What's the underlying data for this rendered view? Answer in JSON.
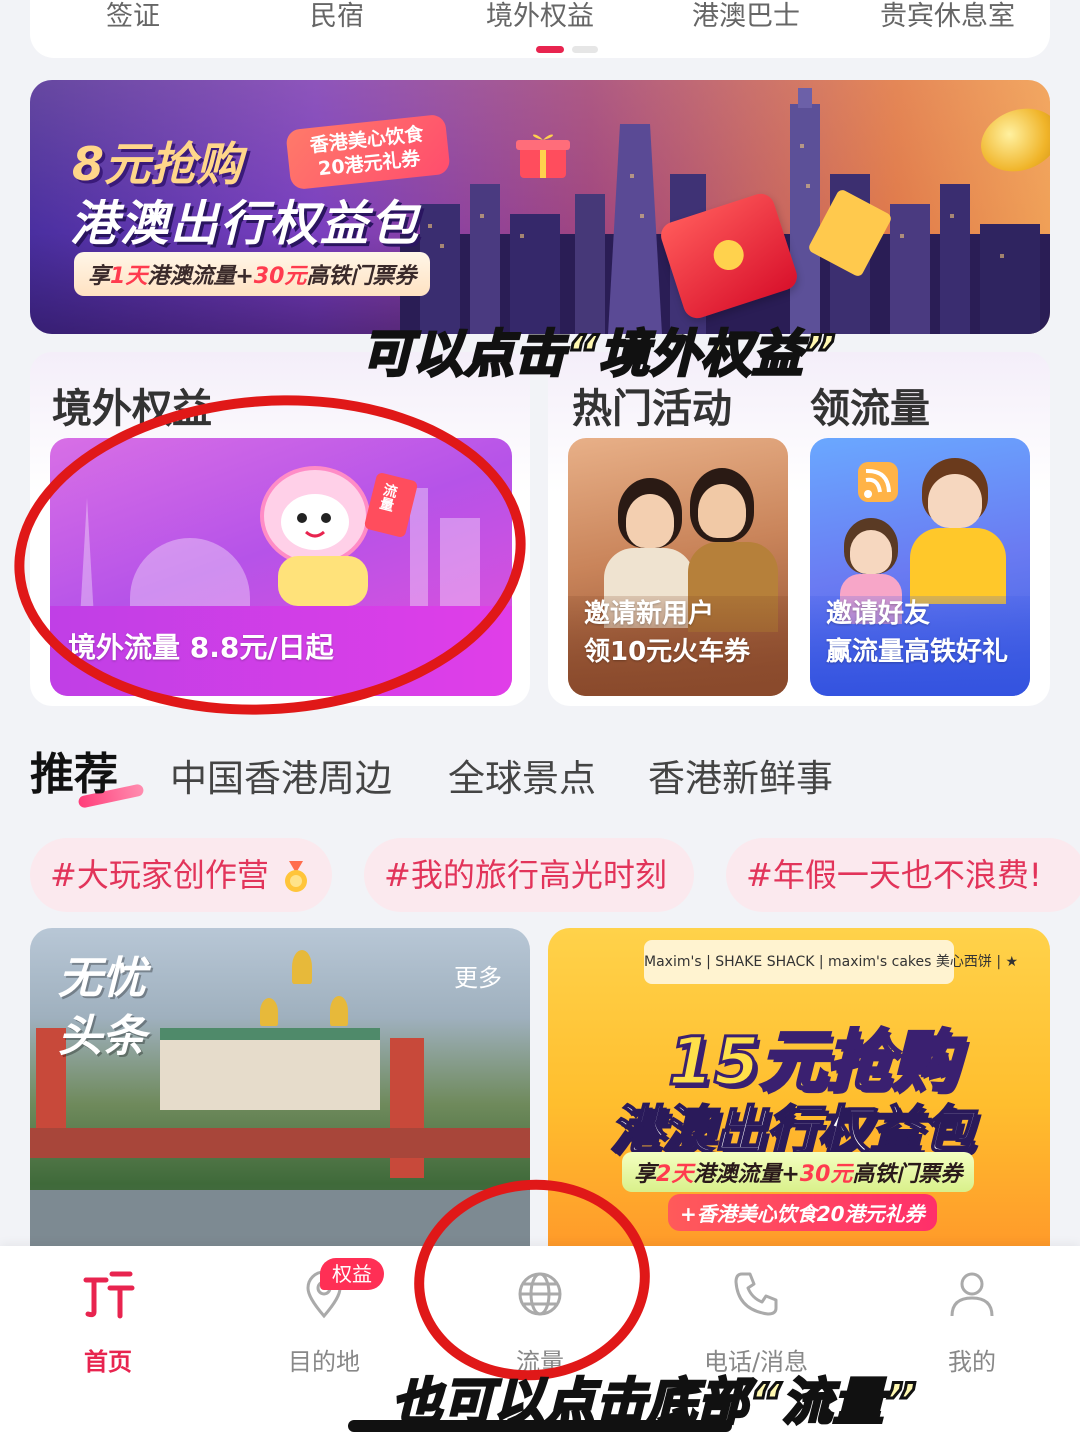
{
  "top_categories": {
    "items": [
      {
        "label": "签证"
      },
      {
        "label": "民宿"
      },
      {
        "label": "境外权益"
      },
      {
        "label": "港澳巴士"
      },
      {
        "label": "贵宾休息室"
      }
    ],
    "accent_color": "#e8244f"
  },
  "banner": {
    "title_line1": "8元抢购",
    "tag": "香港美心饮食20港元礼券",
    "title_line2": "港澳出行权益包",
    "subtitle_pre": "享",
    "subtitle_hl1": "1天",
    "subtitle_mid": "港澳流量+",
    "subtitle_hl2": "30元",
    "subtitle_post": "高铁门票券"
  },
  "captions": {
    "top": "可以点击“境外权益”",
    "bottom": "也可以点击底部“流量”"
  },
  "sections": {
    "overseas": {
      "title": "境外权益",
      "tile_label": "境外流量 8.8元/日起",
      "mascot_card": "流量"
    },
    "hot": {
      "title": "热门活动",
      "tile_line1": "邀请新用户",
      "tile_line2": "领10元火车券"
    },
    "flow": {
      "title": "领流量",
      "tile_line1": "邀请好友",
      "tile_line2": "赢流量高铁好礼"
    }
  },
  "recommend": {
    "tabs": [
      {
        "label": "推荐"
      },
      {
        "label": "中国香港周边"
      },
      {
        "label": "全球景点"
      },
      {
        "label": "香港新鲜事"
      }
    ],
    "active_index": 0
  },
  "hashtags": [
    {
      "label": "#大玩家创作营"
    },
    {
      "label": "#我的旅行高光时刻"
    },
    {
      "label": "#年假一天也不浪费!"
    }
  ],
  "feed": {
    "left": {
      "title_line1": "无忧",
      "title_line2": "头条",
      "more": "更多"
    },
    "right": {
      "brands": "Maxim's | SHAKE SHACK | maxim's cakes 美心西饼 | ★",
      "title1": "15元抢购",
      "title2": "港澳出行权益包",
      "sub_pre": "享",
      "sub_hl1": "2天",
      "sub_mid": "港澳流量+",
      "sub_hl2": "30元",
      "sub_post": "高铁门票券",
      "sub2": "+香港美心饮食20港元礼券"
    }
  },
  "bottom_nav": {
    "items": [
      {
        "label": "首页",
        "icon": "home-logo-icon"
      },
      {
        "label": "目的地",
        "icon": "location-pin-icon"
      },
      {
        "label": "流量",
        "icon": "globe-icon"
      },
      {
        "label": "电话/消息",
        "icon": "phone-icon"
      },
      {
        "label": "我的",
        "icon": "person-icon"
      }
    ],
    "badge": "权益",
    "active_index": 0
  }
}
